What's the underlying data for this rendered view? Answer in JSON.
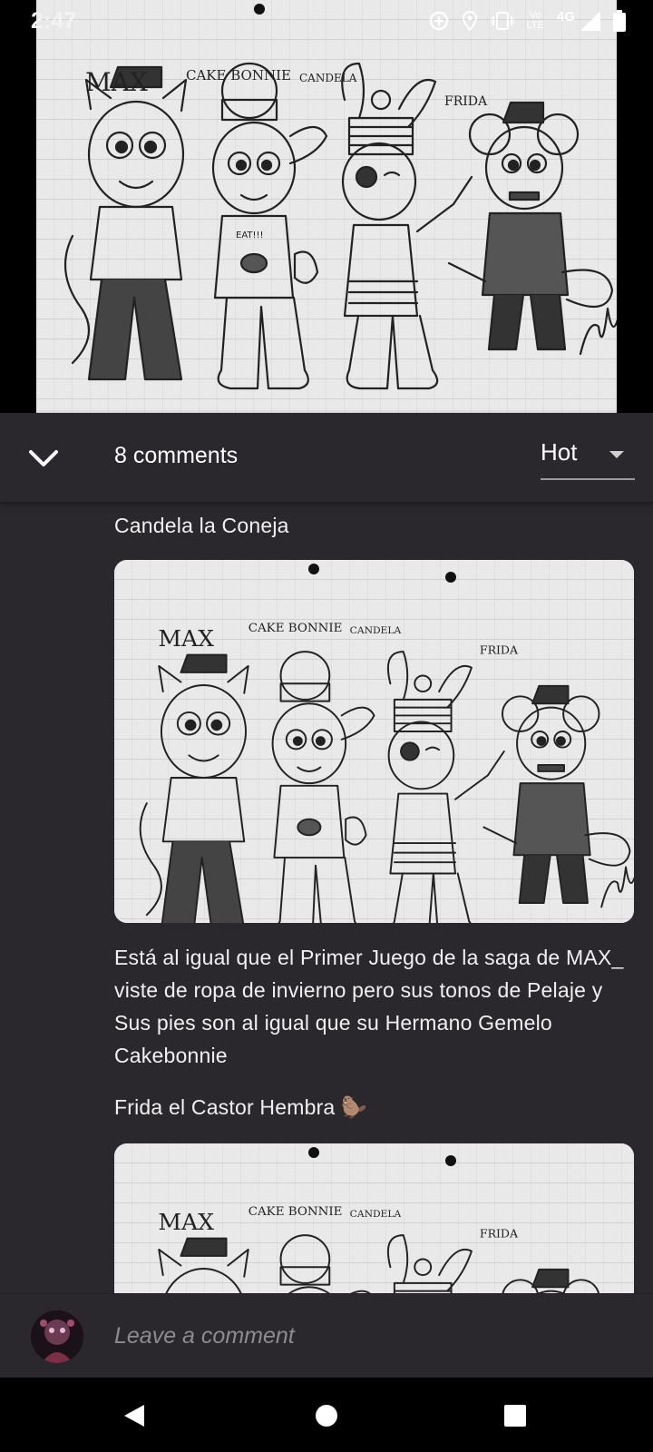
{
  "status_bar": {
    "time": "2:47",
    "volte_top": "Vo",
    "volte_bottom": "LTE",
    "network": "4G",
    "icons": [
      "data-saver-icon",
      "location-icon",
      "vibrate-icon",
      "volte-icon",
      "signal-icon",
      "battery-icon"
    ]
  },
  "drawing": {
    "names": [
      "MAX",
      "CAKE BONNIE",
      "CANDELA",
      "FRIDA"
    ],
    "shirt_text": "EAT!!!"
  },
  "comments_header": {
    "count_label": "8 comments",
    "sort_value": "Hot",
    "collapse_icon": "chevron-down-icon"
  },
  "content": {
    "heading_candela": "Candela la Coneja",
    "description": "Está al igual que el Primer Juego de la saga de MAX_ viste de ropa de invierno pero sus tonos de Pelaje y Sus pies son al igual que su Hermano Gemelo Cakebonnie",
    "heading_frida": "Frida el Castor Hembra 🦫"
  },
  "comment_bar": {
    "placeholder": "Leave a comment"
  },
  "nav": {
    "back": "back-icon",
    "home": "home-icon",
    "recents": "recents-icon"
  },
  "colors": {
    "panel": "#2a282c",
    "text": "#f0f0f0",
    "placeholder": "#8d8b8f",
    "paper": "#e9e9e9"
  }
}
